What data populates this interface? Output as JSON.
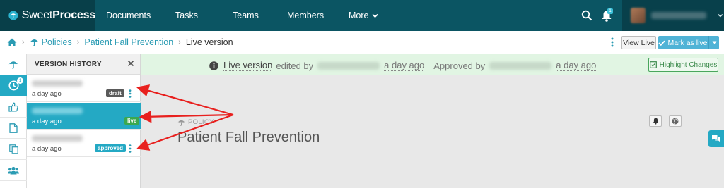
{
  "app": {
    "logo_prefix": "Sweet",
    "logo_suffix": "Process"
  },
  "nav": {
    "items": [
      "Documents",
      "Tasks",
      "Teams",
      "Members"
    ],
    "more_label": "More",
    "notification_count": "1"
  },
  "breadcrumb": {
    "home_icon": "home-icon",
    "section": "Policies",
    "document": "Patient Fall Prevention",
    "current": "Live version"
  },
  "actions": {
    "view_live": "View Live",
    "mark_as_live": "Mark as live"
  },
  "rail": {
    "history_count": "1",
    "icons": [
      "umbrella-icon",
      "clock-icon",
      "thumbs-up-icon",
      "document-icon",
      "copy-icon",
      "users-icon"
    ]
  },
  "version_history": {
    "title": "VERSION HISTORY",
    "items": [
      {
        "time": "a day ago",
        "badge": "draft",
        "selected": false
      },
      {
        "time": "a day ago",
        "badge": "live",
        "selected": true
      },
      {
        "time": "a day ago",
        "badge": "approved",
        "selected": false
      }
    ]
  },
  "banner": {
    "live_version": "Live version",
    "edited_by": "edited by",
    "edited_when": "a day ago",
    "approved_by": "Approved by",
    "approved_when": "a day ago",
    "highlight_button": "Highlight Changes"
  },
  "document": {
    "type": "POLICY",
    "title": "Patient Fall Prevention"
  },
  "colors": {
    "nav_bg": "#0b5563",
    "accent": "#24a9c4",
    "live_green": "#3aa84f",
    "draft_gray": "#5a5a5a",
    "arrow_red": "#e8201e"
  }
}
